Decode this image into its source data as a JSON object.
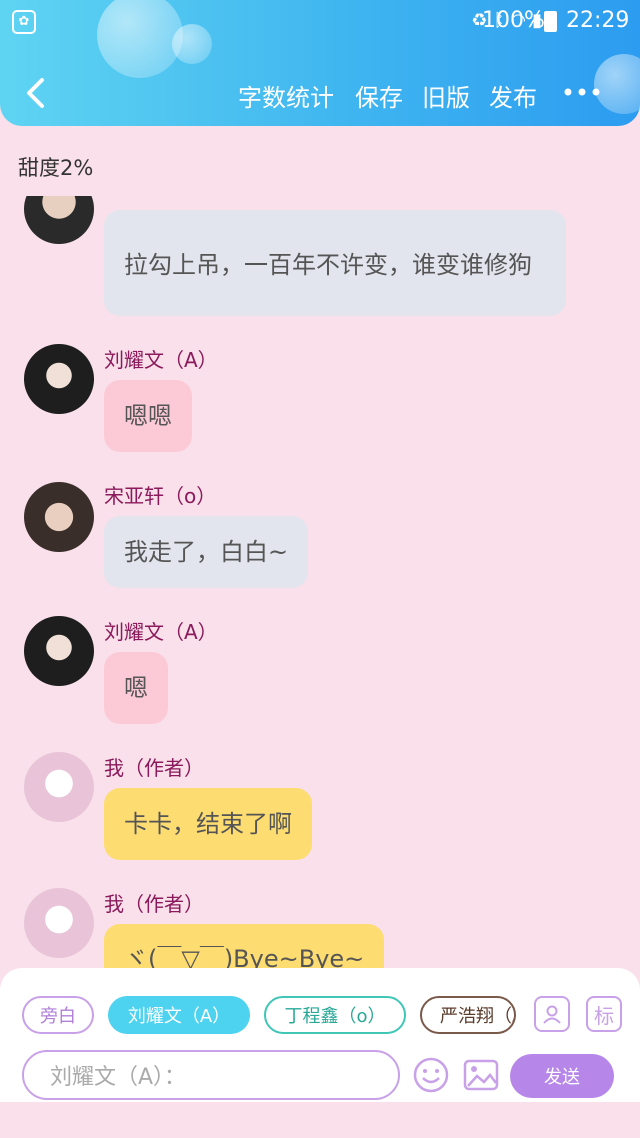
{
  "status_bar": {
    "battery": "100%",
    "time": "22:29",
    "app_icon": "paw-icon"
  },
  "header": {
    "back_icon": "chevron-left-icon",
    "buttons": [
      "字数统计",
      "保存",
      "旧版",
      "发布"
    ],
    "more_icon": "more-dots-icon"
  },
  "sweetness": "甜度2%",
  "messages": [
    {
      "sender": "",
      "text": "拉勾上吊，一百年不许变，谁变谁修狗",
      "style": "gray"
    },
    {
      "sender": "刘耀文（A）",
      "text": "嗯嗯",
      "style": "pink"
    },
    {
      "sender": "宋亚轩（o）",
      "text": "我走了，白白~",
      "style": "gray"
    },
    {
      "sender": "刘耀文（A）",
      "text": "嗯",
      "style": "pink"
    },
    {
      "sender": "我（作者）",
      "text": "卡卡，结束了啊",
      "style": "yellow"
    },
    {
      "sender": "我（作者）",
      "text": "ヾ(￣▽￣)Bye~Bye~",
      "style": "yellow"
    }
  ],
  "roles": [
    "旁白",
    "刘耀文（A）",
    "丁程鑫（o）",
    "严浩翔（A）"
  ],
  "side_buttons": {
    "character": "character-icon",
    "tag": "标"
  },
  "input": {
    "placeholder": "刘耀文（A）："
  },
  "send_label": "发送",
  "colors": {
    "header": "#3fb5f0",
    "background": "#f9e0ea",
    "send": "#b687e8"
  }
}
